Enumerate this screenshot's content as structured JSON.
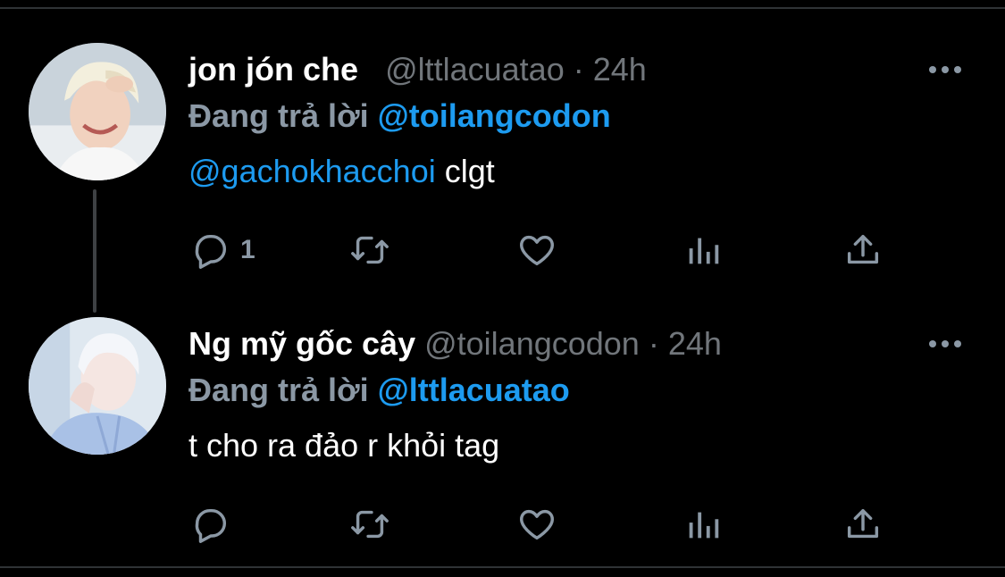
{
  "tweets": [
    {
      "display_name": "jon jón che",
      "handle": "@lttlacuatao",
      "separator": "·",
      "time": "24h",
      "replying_prefix": "Đang trả lời",
      "replying_to": "@toilangcodon",
      "body_mention": "@gachokhacchoi",
      "body_text": " clgt",
      "reply_count": "1"
    },
    {
      "display_name": "Ng mỹ gốc cây",
      "handle": "@toilangcodon",
      "separator": "·",
      "time": "24h",
      "replying_prefix": "Đang trả lời",
      "replying_to": "@lttlacuatao",
      "body_mention": "",
      "body_text": "t cho ra đảo r khỏi tag",
      "reply_count": ""
    }
  ],
  "icons": {
    "reply": "reply-icon",
    "retweet": "retweet-icon",
    "like": "heart-icon",
    "stats": "analytics-icon",
    "share": "share-icon",
    "more": "more-icon"
  },
  "colors": {
    "background": "#000000",
    "accent": "#1d9bf0",
    "muted": "#71767b",
    "text": "#ffffff"
  }
}
